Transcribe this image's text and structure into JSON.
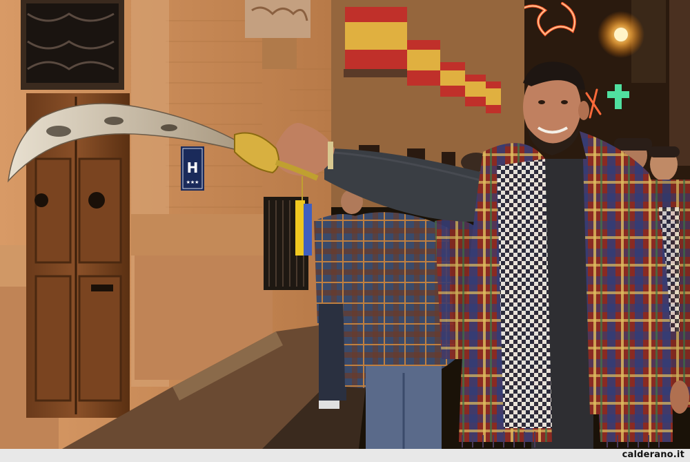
{
  "photo": {
    "hotel_sign": "H",
    "watermark": "calderano.it"
  },
  "colors": {
    "wall": "#c98c5a",
    "door": "#7a4420",
    "sky": "#1a1208",
    "tartan_red": "#b23a2a",
    "tartan_blue": "#3a4a8a",
    "flag_red": "#c0302a",
    "flag_yellow": "#e0b040"
  }
}
